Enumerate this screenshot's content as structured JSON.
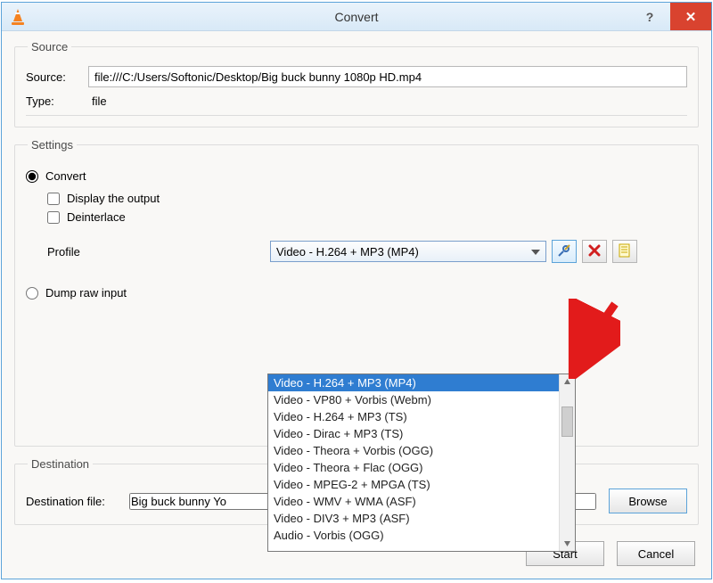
{
  "window": {
    "title": "Convert",
    "help_symbol": "?",
    "close_symbol": "✕"
  },
  "source_group": {
    "legend": "Source",
    "source_label": "Source:",
    "source_value": "file:///C:/Users/Softonic/Desktop/Big buck bunny 1080p HD.mp4",
    "type_label": "Type:",
    "type_value": "file"
  },
  "settings_group": {
    "legend": "Settings",
    "convert_label": "Convert",
    "display_output_label": "Display the output",
    "deinterlace_label": "Deinterlace",
    "profile_label": "Profile",
    "profile_selected": "Video - H.264 + MP3 (MP4)",
    "dump_raw_label": "Dump raw input"
  },
  "profile_options": [
    "Video - H.264 + MP3 (MP4)",
    "Video - VP80 + Vorbis (Webm)",
    "Video - H.264 + MP3 (TS)",
    "Video - Dirac + MP3 (TS)",
    "Video - Theora + Vorbis (OGG)",
    "Video - Theora + Flac (OGG)",
    "Video - MPEG-2 + MPGA (TS)",
    "Video - WMV + WMA (ASF)",
    "Video - DIV3 + MP3 (ASF)",
    "Audio - Vorbis (OGG)"
  ],
  "icon_buttons": {
    "edit": "edit-profile-icon",
    "delete": "delete-profile-icon",
    "new": "new-profile-icon"
  },
  "destination_group": {
    "legend": "Destination",
    "label": "Destination file:",
    "value": "Big buck bunny Yo",
    "browse_label": "Browse"
  },
  "bottom": {
    "start_label": "Start",
    "cancel_label": "Cancel"
  }
}
